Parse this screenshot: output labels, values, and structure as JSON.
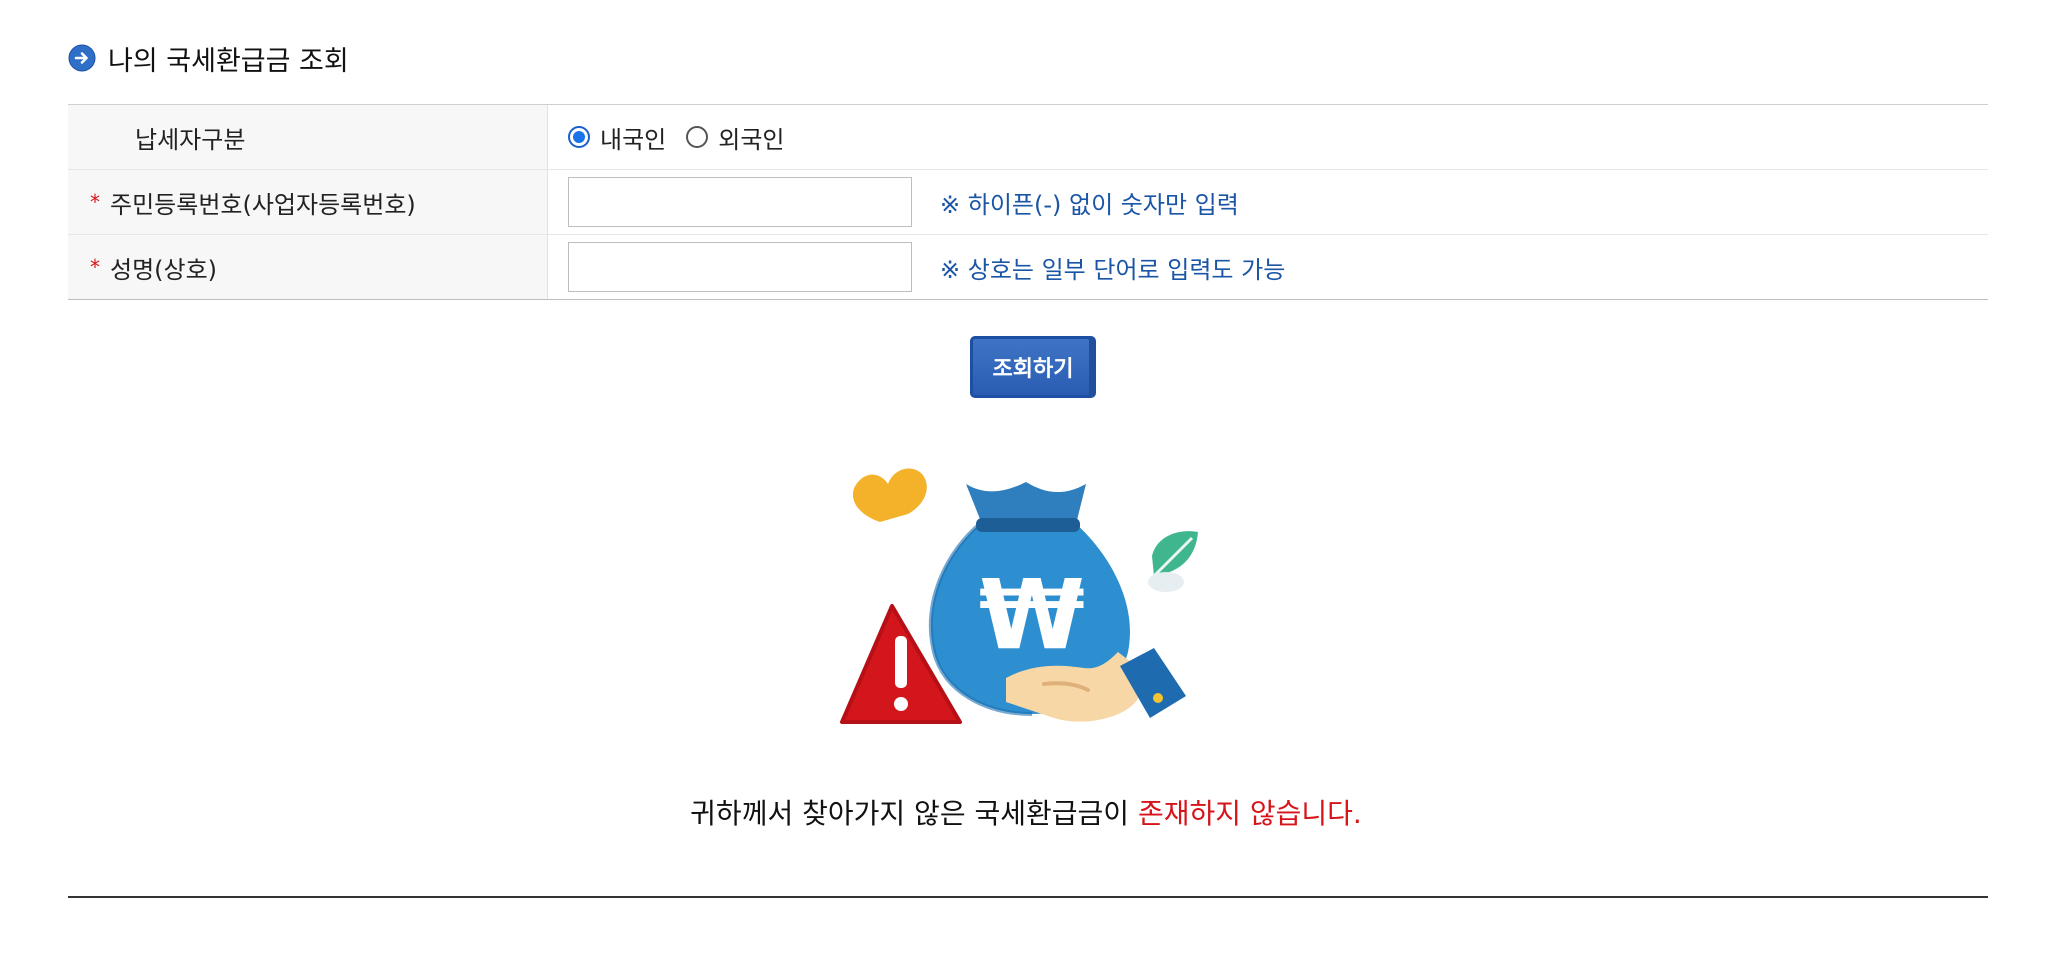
{
  "section": {
    "title": "나의 국세환급금 조회"
  },
  "form": {
    "rows": [
      {
        "label": "납세자구분",
        "required": false,
        "options": [
          {
            "label": "내국인",
            "checked": true
          },
          {
            "label": "외국인",
            "checked": false
          }
        ]
      },
      {
        "label": "주민등록번호(사업자등록번호)",
        "required": true,
        "value": "",
        "placeholder": "",
        "hint": "※ 하이픈(-) 없이 숫자만 입력"
      },
      {
        "label": "성명(상호)",
        "required": true,
        "value": "",
        "placeholder": "",
        "hint": "※ 상호는 일부 단어로 입력도 가능"
      }
    ],
    "required_mark": "*"
  },
  "search_button": {
    "label": "조회하기"
  },
  "illustration": {
    "name": "money-bag-warning-illustration",
    "symbol": "₩"
  },
  "result": {
    "message_prefix": "귀하께서 찾아가지 않은 국세환급금이 ",
    "message_highlight": "존재하지 않습니다."
  },
  "colors": {
    "accent_blue": "#2a5db2",
    "hint_blue": "#1a55a6",
    "alert_red": "#d7141a"
  }
}
